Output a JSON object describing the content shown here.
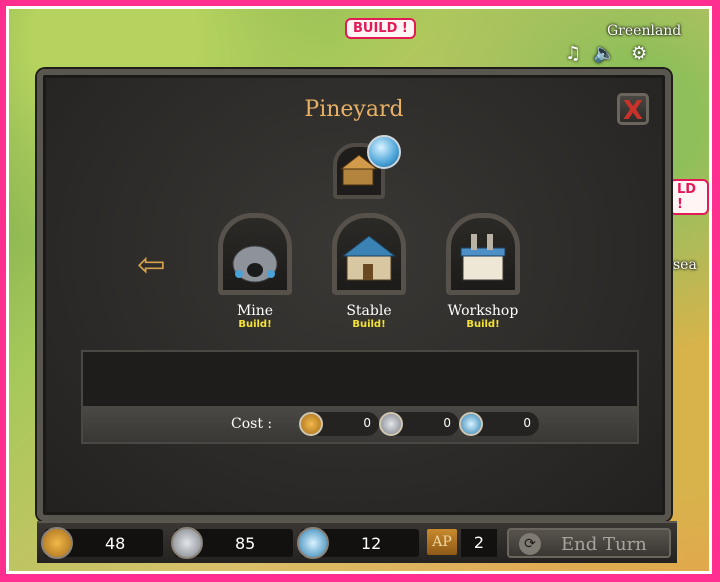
{
  "map": {
    "build_badge": "BUILD !",
    "side_badge": "LD !",
    "region_label": "Greenland",
    "sea_label": "sea"
  },
  "dialog": {
    "title": "Pineyard",
    "close_label": "X"
  },
  "buildings": [
    {
      "name": "Mine",
      "status": "Build!"
    },
    {
      "name": "Stable",
      "status": "Build!"
    },
    {
      "name": "Workshop",
      "status": "Build!"
    }
  ],
  "cost": {
    "label": "Cost :",
    "gold": "0",
    "iron": "0",
    "crystal": "0"
  },
  "hud": {
    "gold": "48",
    "iron": "85",
    "crystal": "12",
    "ap_label": "AP",
    "ap_value": "2",
    "end_turn_label": "End Turn"
  },
  "colors": {
    "frame": "#ff2f8f",
    "title": "#e8b165",
    "build_status": "#f4e234",
    "close_x": "#c8322b"
  }
}
